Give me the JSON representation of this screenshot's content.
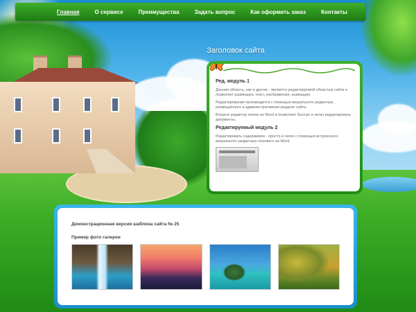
{
  "nav": {
    "items": [
      {
        "label": "Главная"
      },
      {
        "label": "О сервисе"
      },
      {
        "label": "Преимущества"
      },
      {
        "label": "Задать вопрос"
      },
      {
        "label": "Как оформить заказ"
      },
      {
        "label": "Контакты"
      }
    ]
  },
  "site_title": "Заголовок сайта",
  "modules": {
    "module1": {
      "title": "Ред. модуль 1",
      "paragraphs": [
        "Данная область, как и другие - является редактируемой областью сайта и позволяет размещать текст, изображения, анимацию.",
        "Редактирование производится с помощью визуального редактора, размещённого в административном разделе сайта.",
        "Внешне редактор похож на Word и позволяет быстро и легко редактировать документы."
      ]
    },
    "module2": {
      "title": "Редактируемый модуль 2",
      "paragraphs": [
        "Редактировать содержимое - просто и легко с помощью встроенного визуального редактора похожего на Word."
      ]
    }
  },
  "content": {
    "demo_text": "Демонстрационная версия шаблона сайта № 25",
    "gallery_title": "Пример фото галереи",
    "photos": [
      {
        "icon": "waterfall-photo"
      },
      {
        "icon": "sunset-photo"
      },
      {
        "icon": "island-photo"
      },
      {
        "icon": "autumn-field-photo"
      }
    ]
  },
  "colors": {
    "nav_green": "#1d7c14",
    "panel_green": "#3db028",
    "content_blue": "#39b7ea"
  }
}
